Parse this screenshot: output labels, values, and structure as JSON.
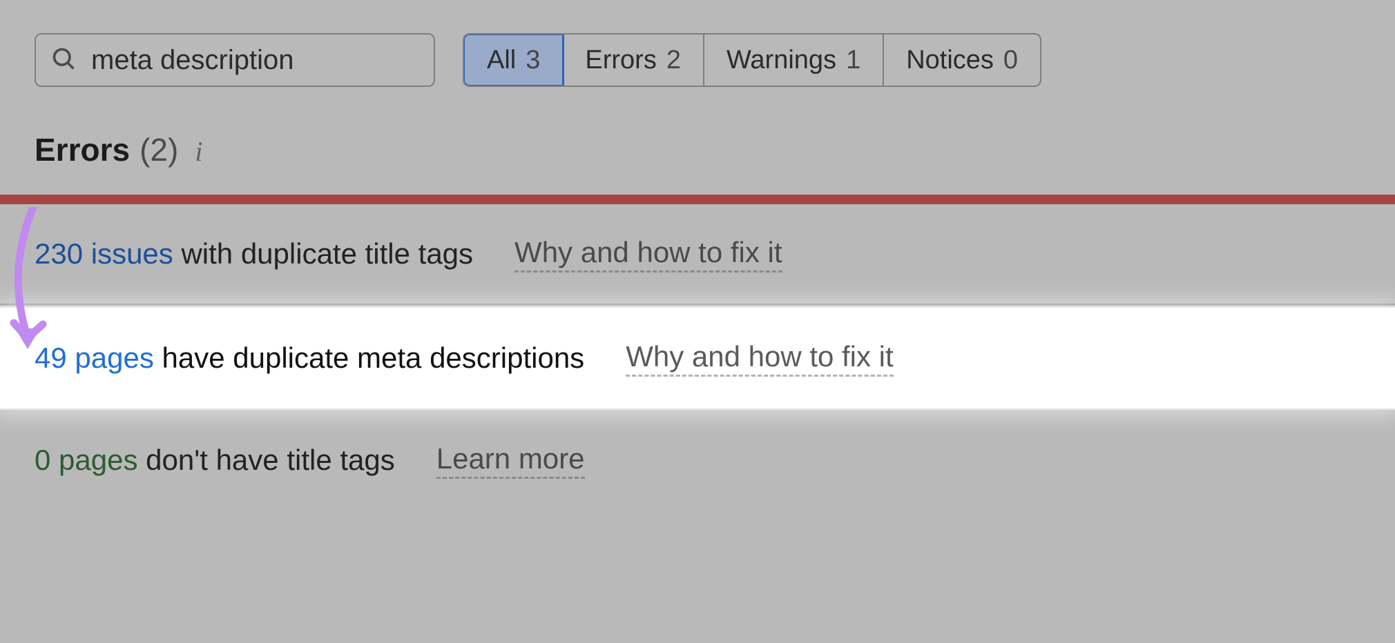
{
  "search": {
    "value": "meta description"
  },
  "tabs": {
    "all": {
      "label": "All",
      "count": "3"
    },
    "errors": {
      "label": "Errors",
      "count": "2"
    },
    "warnings": {
      "label": "Warnings",
      "count": "1"
    },
    "notices": {
      "label": "Notices",
      "count": "0"
    }
  },
  "section": {
    "title": "Errors",
    "count": "(2)"
  },
  "rows": [
    {
      "count": "230 issues",
      "text": "with duplicate title tags",
      "fix": "Why and how to fix it"
    },
    {
      "count": "49 pages",
      "text": "have duplicate meta descriptions",
      "fix": "Why and how to fix it"
    },
    {
      "count": "0 pages",
      "text": "don't have title tags",
      "fix": "Learn more"
    }
  ]
}
